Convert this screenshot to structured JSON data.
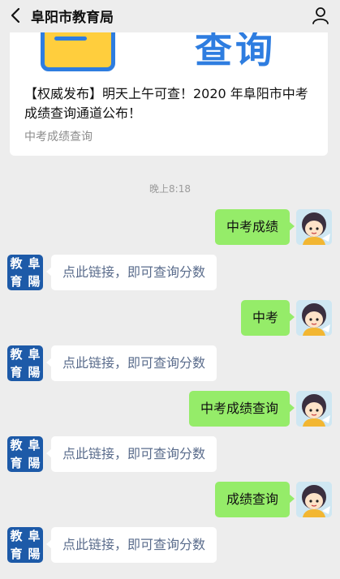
{
  "header": {
    "title": "阜阳市教育局",
    "back_icon": "chevron-left-icon",
    "profile_icon": "person-icon"
  },
  "article": {
    "banner_text": "查询",
    "title": "【权威发布】明天上午可查！2020 年阜阳市中考成绩查询通道公布！",
    "source": "中考成绩查询"
  },
  "timestamp": "晚上8:18",
  "bot_avatar_chars": [
    "教",
    "阜",
    "育",
    "陽"
  ],
  "messages": [
    {
      "from": "user",
      "text": "中考成绩"
    },
    {
      "from": "bot",
      "text": "点此链接，即可查询分数"
    },
    {
      "from": "user",
      "text": "中考"
    },
    {
      "from": "bot",
      "text": "点此链接，即可查询分数"
    },
    {
      "from": "user",
      "text": "中考成绩查询"
    },
    {
      "from": "bot",
      "text": "点此链接，即可查询分数"
    },
    {
      "from": "user",
      "text": "成绩查询"
    },
    {
      "from": "bot",
      "text": "点此链接，即可查询分数"
    }
  ],
  "colors": {
    "background": "#ededed",
    "user_bubble": "#95ec69",
    "bot_bubble": "#ffffff",
    "link_text": "#5a6c8c",
    "accent_blue": "#2e7de0"
  }
}
